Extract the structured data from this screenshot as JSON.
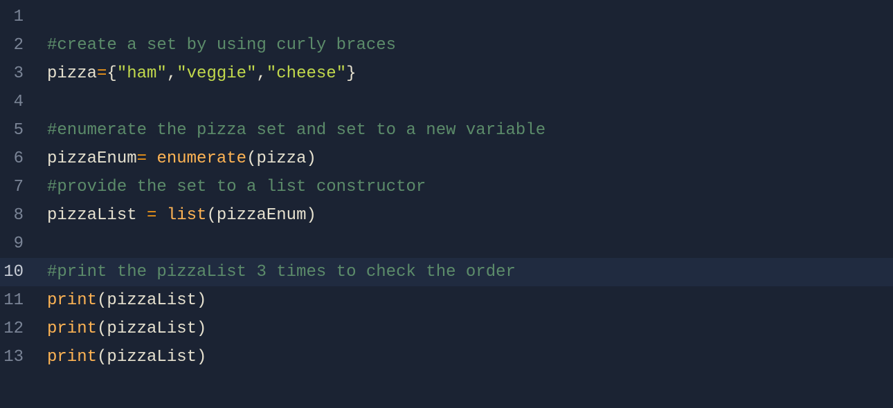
{
  "editor": {
    "active_line": 10,
    "lines": [
      {
        "n": 1,
        "tokens": []
      },
      {
        "n": 2,
        "tokens": [
          {
            "t": "#create a set by using curly braces",
            "c": "tok-comment"
          }
        ]
      },
      {
        "n": 3,
        "tokens": [
          {
            "t": "pizza",
            "c": "tok-ident"
          },
          {
            "t": "=",
            "c": "tok-op"
          },
          {
            "t": "{",
            "c": "tok-punct"
          },
          {
            "t": "\"ham\"",
            "c": "tok-string"
          },
          {
            "t": ",",
            "c": "tok-punct"
          },
          {
            "t": "\"veggie\"",
            "c": "tok-string"
          },
          {
            "t": ",",
            "c": "tok-punct"
          },
          {
            "t": "\"cheese\"",
            "c": "tok-string"
          },
          {
            "t": "}",
            "c": "tok-punct"
          }
        ]
      },
      {
        "n": 4,
        "tokens": []
      },
      {
        "n": 5,
        "tokens": [
          {
            "t": "#enumerate the pizza set and set to a new variable",
            "c": "tok-comment"
          }
        ]
      },
      {
        "n": 6,
        "tokens": [
          {
            "t": "pizzaEnum",
            "c": "tok-ident"
          },
          {
            "t": "= ",
            "c": "tok-op"
          },
          {
            "t": "enumerate",
            "c": "tok-builtin"
          },
          {
            "t": "(",
            "c": "tok-punct"
          },
          {
            "t": "pizza",
            "c": "tok-ident"
          },
          {
            "t": ")",
            "c": "tok-punct"
          }
        ]
      },
      {
        "n": 7,
        "tokens": [
          {
            "t": "#provide the set to a list constructor",
            "c": "tok-comment"
          }
        ]
      },
      {
        "n": 8,
        "tokens": [
          {
            "t": "pizzaList ",
            "c": "tok-ident"
          },
          {
            "t": "= ",
            "c": "tok-op"
          },
          {
            "t": "list",
            "c": "tok-builtin"
          },
          {
            "t": "(",
            "c": "tok-punct"
          },
          {
            "t": "pizzaEnum",
            "c": "tok-ident"
          },
          {
            "t": ")",
            "c": "tok-punct"
          }
        ]
      },
      {
        "n": 9,
        "tokens": []
      },
      {
        "n": 10,
        "tokens": [
          {
            "t": "#print the pizzaList 3 times to check the order",
            "c": "tok-comment"
          }
        ]
      },
      {
        "n": 11,
        "tokens": [
          {
            "t": "print",
            "c": "tok-builtin"
          },
          {
            "t": "(",
            "c": "tok-punct"
          },
          {
            "t": "pizzaList",
            "c": "tok-ident"
          },
          {
            "t": ")",
            "c": "tok-punct"
          }
        ]
      },
      {
        "n": 12,
        "tokens": [
          {
            "t": "print",
            "c": "tok-builtin"
          },
          {
            "t": "(",
            "c": "tok-punct"
          },
          {
            "t": "pizzaList",
            "c": "tok-ident"
          },
          {
            "t": ")",
            "c": "tok-punct"
          }
        ]
      },
      {
        "n": 13,
        "tokens": [
          {
            "t": "print",
            "c": "tok-builtin"
          },
          {
            "t": "(",
            "c": "tok-punct"
          },
          {
            "t": "pizzaList",
            "c": "tok-ident"
          },
          {
            "t": ")",
            "c": "tok-punct"
          }
        ]
      }
    ]
  }
}
